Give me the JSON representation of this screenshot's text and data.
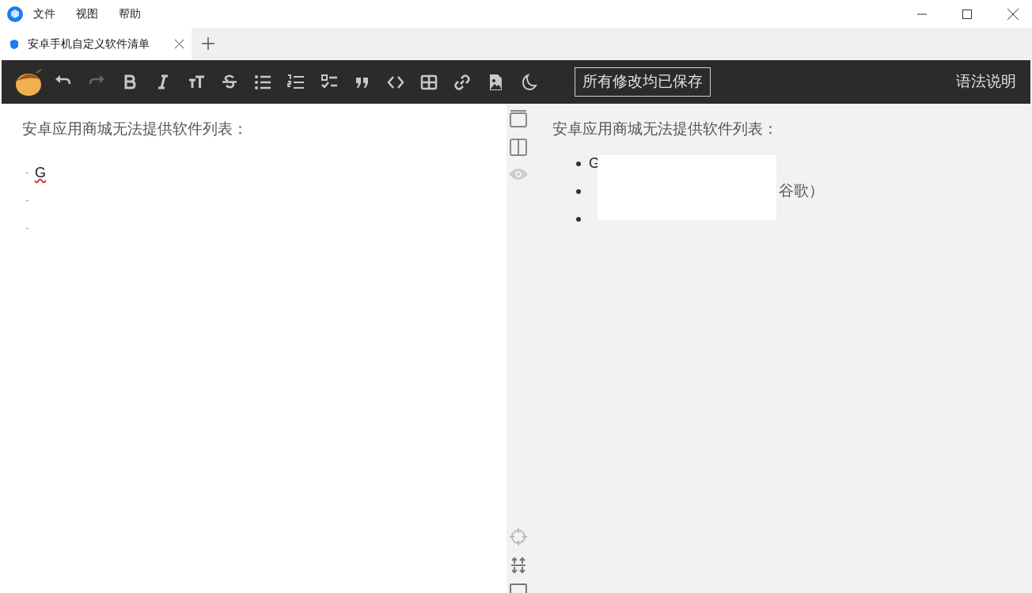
{
  "menu": [
    "文件",
    "视图",
    "帮助"
  ],
  "tabs": [
    {
      "label": "安卓手机自定义软件清单",
      "selected": true
    }
  ],
  "toolbar": {
    "tools": [
      {
        "kind": "undo",
        "disabled": false
      },
      {
        "kind": "redo",
        "disabled": true
      },
      {
        "kind": "bold",
        "disabled": false
      },
      {
        "kind": "italic",
        "disabled": false
      },
      {
        "kind": "heading",
        "disabled": false
      },
      {
        "kind": "strike",
        "disabled": false
      },
      {
        "kind": "ul",
        "disabled": false
      },
      {
        "kind": "ol",
        "disabled": false
      },
      {
        "kind": "task",
        "disabled": false
      },
      {
        "kind": "quote",
        "disabled": false
      },
      {
        "kind": "code",
        "disabled": false
      },
      {
        "kind": "table",
        "disabled": false
      },
      {
        "kind": "link",
        "disabled": false
      },
      {
        "kind": "image",
        "disabled": false
      },
      {
        "kind": "moon",
        "disabled": false
      }
    ],
    "save_status": "所有修改均已保存",
    "help": "语法说明"
  },
  "editor": {
    "heading": "安卓应用商城无法提供软件列表：",
    "lines": [
      {
        "marker": "-",
        "text": "G",
        "misspelled": true
      },
      {
        "marker": "-"
      },
      {
        "marker": "-"
      }
    ]
  },
  "preview": {
    "heading": "安卓应用商城无法提供软件列表：",
    "items": [
      {
        "kind": "bullet",
        "before": "G"
      },
      {
        "kind": "bullet",
        "after": "谷歌）"
      },
      {
        "kind": "bullet"
      }
    ]
  }
}
